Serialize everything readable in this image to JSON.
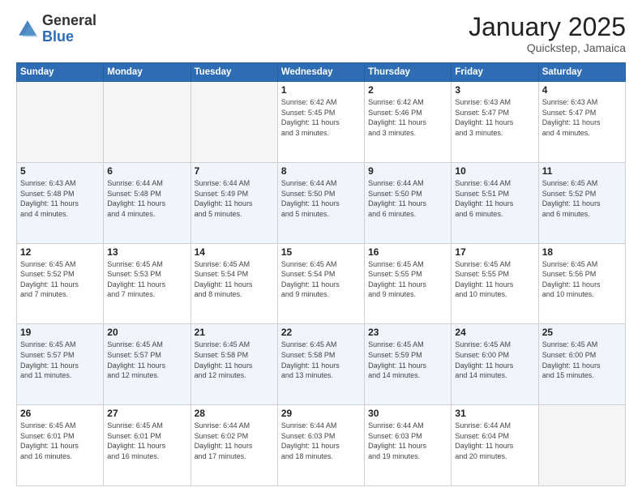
{
  "header": {
    "logo_general": "General",
    "logo_blue": "Blue",
    "month_title": "January 2025",
    "subtitle": "Quickstep, Jamaica"
  },
  "weekdays": [
    "Sunday",
    "Monday",
    "Tuesday",
    "Wednesday",
    "Thursday",
    "Friday",
    "Saturday"
  ],
  "weeks": [
    [
      {
        "day": "",
        "info": ""
      },
      {
        "day": "",
        "info": ""
      },
      {
        "day": "",
        "info": ""
      },
      {
        "day": "1",
        "info": "Sunrise: 6:42 AM\nSunset: 5:45 PM\nDaylight: 11 hours\nand 3 minutes."
      },
      {
        "day": "2",
        "info": "Sunrise: 6:42 AM\nSunset: 5:46 PM\nDaylight: 11 hours\nand 3 minutes."
      },
      {
        "day": "3",
        "info": "Sunrise: 6:43 AM\nSunset: 5:47 PM\nDaylight: 11 hours\nand 3 minutes."
      },
      {
        "day": "4",
        "info": "Sunrise: 6:43 AM\nSunset: 5:47 PM\nDaylight: 11 hours\nand 4 minutes."
      }
    ],
    [
      {
        "day": "5",
        "info": "Sunrise: 6:43 AM\nSunset: 5:48 PM\nDaylight: 11 hours\nand 4 minutes."
      },
      {
        "day": "6",
        "info": "Sunrise: 6:44 AM\nSunset: 5:48 PM\nDaylight: 11 hours\nand 4 minutes."
      },
      {
        "day": "7",
        "info": "Sunrise: 6:44 AM\nSunset: 5:49 PM\nDaylight: 11 hours\nand 5 minutes."
      },
      {
        "day": "8",
        "info": "Sunrise: 6:44 AM\nSunset: 5:50 PM\nDaylight: 11 hours\nand 5 minutes."
      },
      {
        "day": "9",
        "info": "Sunrise: 6:44 AM\nSunset: 5:50 PM\nDaylight: 11 hours\nand 6 minutes."
      },
      {
        "day": "10",
        "info": "Sunrise: 6:44 AM\nSunset: 5:51 PM\nDaylight: 11 hours\nand 6 minutes."
      },
      {
        "day": "11",
        "info": "Sunrise: 6:45 AM\nSunset: 5:52 PM\nDaylight: 11 hours\nand 6 minutes."
      }
    ],
    [
      {
        "day": "12",
        "info": "Sunrise: 6:45 AM\nSunset: 5:52 PM\nDaylight: 11 hours\nand 7 minutes."
      },
      {
        "day": "13",
        "info": "Sunrise: 6:45 AM\nSunset: 5:53 PM\nDaylight: 11 hours\nand 7 minutes."
      },
      {
        "day": "14",
        "info": "Sunrise: 6:45 AM\nSunset: 5:54 PM\nDaylight: 11 hours\nand 8 minutes."
      },
      {
        "day": "15",
        "info": "Sunrise: 6:45 AM\nSunset: 5:54 PM\nDaylight: 11 hours\nand 9 minutes."
      },
      {
        "day": "16",
        "info": "Sunrise: 6:45 AM\nSunset: 5:55 PM\nDaylight: 11 hours\nand 9 minutes."
      },
      {
        "day": "17",
        "info": "Sunrise: 6:45 AM\nSunset: 5:55 PM\nDaylight: 11 hours\nand 10 minutes."
      },
      {
        "day": "18",
        "info": "Sunrise: 6:45 AM\nSunset: 5:56 PM\nDaylight: 11 hours\nand 10 minutes."
      }
    ],
    [
      {
        "day": "19",
        "info": "Sunrise: 6:45 AM\nSunset: 5:57 PM\nDaylight: 11 hours\nand 11 minutes."
      },
      {
        "day": "20",
        "info": "Sunrise: 6:45 AM\nSunset: 5:57 PM\nDaylight: 11 hours\nand 12 minutes."
      },
      {
        "day": "21",
        "info": "Sunrise: 6:45 AM\nSunset: 5:58 PM\nDaylight: 11 hours\nand 12 minutes."
      },
      {
        "day": "22",
        "info": "Sunrise: 6:45 AM\nSunset: 5:58 PM\nDaylight: 11 hours\nand 13 minutes."
      },
      {
        "day": "23",
        "info": "Sunrise: 6:45 AM\nSunset: 5:59 PM\nDaylight: 11 hours\nand 14 minutes."
      },
      {
        "day": "24",
        "info": "Sunrise: 6:45 AM\nSunset: 6:00 PM\nDaylight: 11 hours\nand 14 minutes."
      },
      {
        "day": "25",
        "info": "Sunrise: 6:45 AM\nSunset: 6:00 PM\nDaylight: 11 hours\nand 15 minutes."
      }
    ],
    [
      {
        "day": "26",
        "info": "Sunrise: 6:45 AM\nSunset: 6:01 PM\nDaylight: 11 hours\nand 16 minutes."
      },
      {
        "day": "27",
        "info": "Sunrise: 6:45 AM\nSunset: 6:01 PM\nDaylight: 11 hours\nand 16 minutes."
      },
      {
        "day": "28",
        "info": "Sunrise: 6:44 AM\nSunset: 6:02 PM\nDaylight: 11 hours\nand 17 minutes."
      },
      {
        "day": "29",
        "info": "Sunrise: 6:44 AM\nSunset: 6:03 PM\nDaylight: 11 hours\nand 18 minutes."
      },
      {
        "day": "30",
        "info": "Sunrise: 6:44 AM\nSunset: 6:03 PM\nDaylight: 11 hours\nand 19 minutes."
      },
      {
        "day": "31",
        "info": "Sunrise: 6:44 AM\nSunset: 6:04 PM\nDaylight: 11 hours\nand 20 minutes."
      },
      {
        "day": "",
        "info": ""
      }
    ]
  ]
}
